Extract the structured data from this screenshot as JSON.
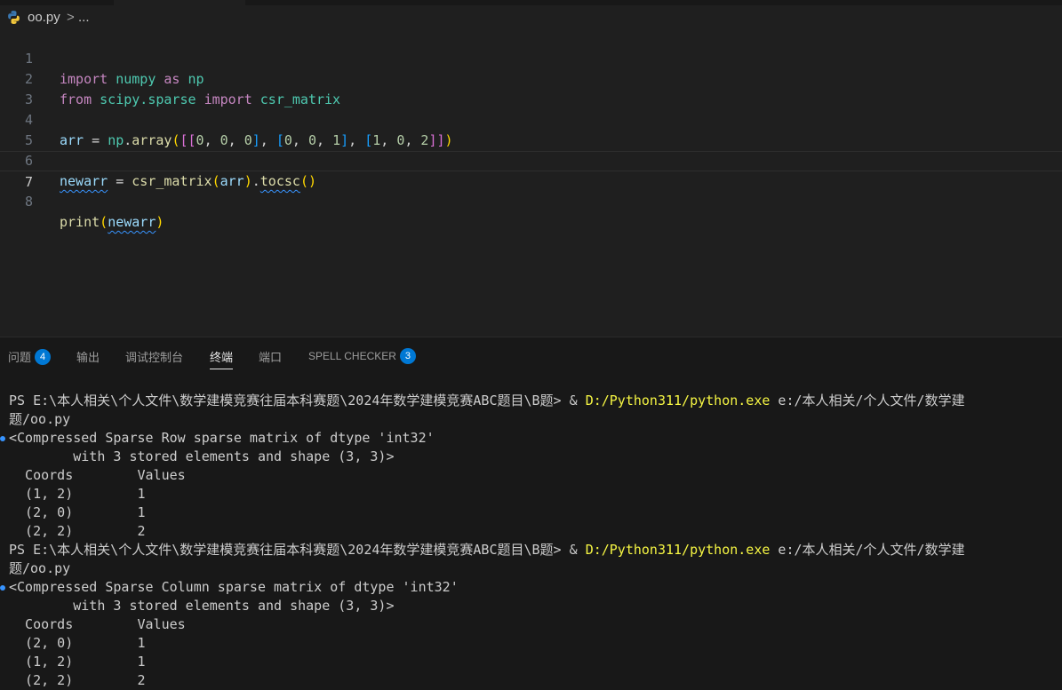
{
  "breadcrumb": {
    "file_icon": "python-icon",
    "file": "oo.py",
    "separator": ">",
    "more": "..."
  },
  "editor": {
    "line_numbers": [
      "1",
      "2",
      "3",
      "4",
      "5",
      "6",
      "7",
      "8"
    ],
    "current_line": "7",
    "tokens": {
      "import": "import",
      "numpy": "numpy",
      "as": "as",
      "np": "np",
      "from": "from",
      "scipy_sparse": "scipy.sparse",
      "import2": "import",
      "csr_matrix": "csr_matrix",
      "arr": "arr",
      "eq": " = ",
      "np2": "np",
      "dot": ".",
      "array": "array",
      "l4_args_1": "[[",
      "n0a": "0",
      "c1": ", ",
      "n0b": "0",
      "c2": ", ",
      "n0c": "0",
      "r1": "]",
      "c3": ", ",
      "l4_b2": "[",
      "n0d": "0",
      "c4": ", ",
      "n0e": "0",
      "c5": ", ",
      "n1a": "1",
      "r2": "]",
      "c6": ", ",
      "l4_b3": "[",
      "n1b": "1",
      "c7": ", ",
      "n0f": "0",
      "c8": ", ",
      "n2a": "2",
      "r3": "]]",
      "paren_open": "(",
      "paren_close": ")",
      "newarr": "newarr",
      "eq2": " = ",
      "csr_matrix2": "csr_matrix",
      "arr2": "arr",
      "dot2": ".",
      "tocsc": "tocsc",
      "call": "()",
      "print": "print",
      "newarr2": "newarr"
    }
  },
  "panel": {
    "tabs": [
      {
        "label": "问题",
        "badge": "4"
      },
      {
        "label": "输出"
      },
      {
        "label": "调试控制台"
      },
      {
        "label": "终端",
        "active": true
      },
      {
        "label": "端口"
      },
      {
        "label": "SPELL CHECKER",
        "badge": "3"
      }
    ],
    "terminal": {
      "run1_prompt": "PS E:\\本人相关\\个人文件\\数学建模竞赛往届本科赛题\\2024年数学建模竞赛ABC题目\\B题> ",
      "amp": "& ",
      "python_path": "D:/Python311/python.exe",
      "script_arg": " e:/本人相关/个人文件/数学建",
      "wrap": "题/oo.py",
      "out1_line1": "<Compressed Sparse Row sparse matrix of dtype 'int32'",
      "out_line2": "        with 3 stored elements and shape (3, 3)>",
      "out_header": "  Coords        Values",
      "out1_rows": [
        "  (1, 2)        1",
        "  (2, 0)        1",
        "  (2, 2)        2"
      ],
      "out2_line1": "<Compressed Sparse Column sparse matrix of dtype 'int32'",
      "out2_rows": [
        "  (2, 0)        1",
        "  (1, 2)        1",
        "  (2, 2)        2"
      ]
    }
  },
  "colors": {
    "background": "#1f1f1f",
    "keyword": "#c586c0",
    "module": "#4ec9b0",
    "variable": "#9cdcfe",
    "function": "#dcdcaa",
    "number": "#b5cea8",
    "accent": "#0078d4",
    "terminal_path": "#f5f543"
  }
}
